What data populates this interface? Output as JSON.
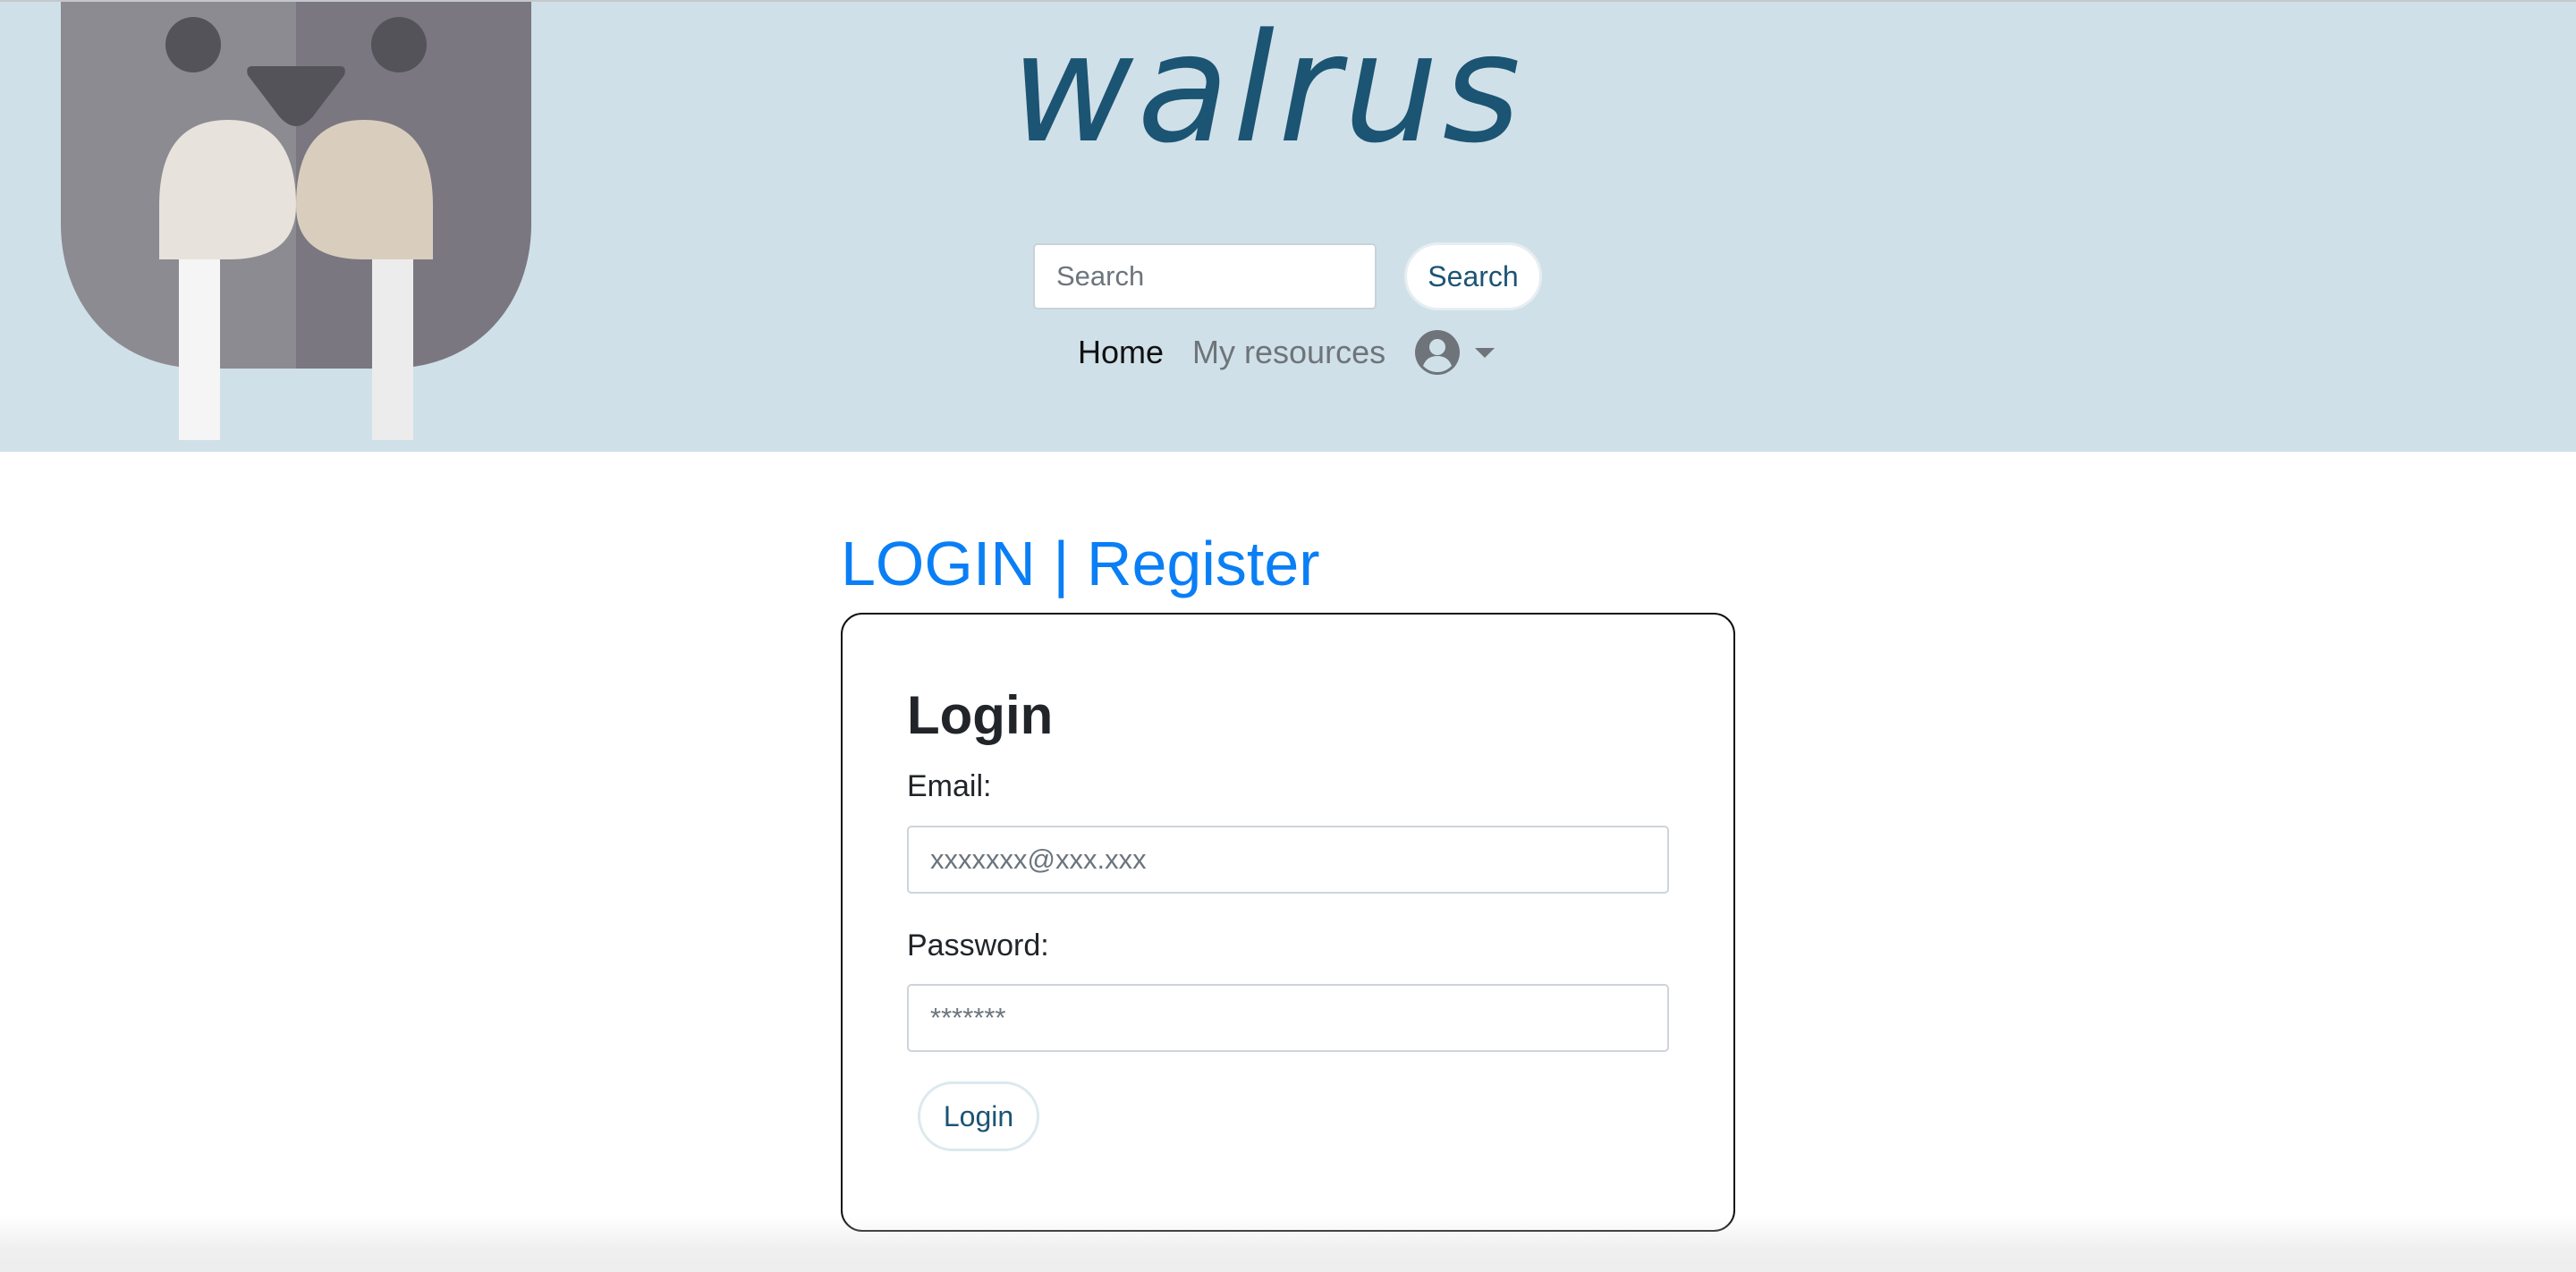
{
  "header": {
    "brand": "walrus",
    "logo_icon": "walrus-face-icon",
    "background_color": "#d0e0e8",
    "brand_color": "#1c5473",
    "search": {
      "placeholder": "Search",
      "value": "",
      "button_label": "Search"
    },
    "nav": {
      "home_label": "Home",
      "resources_label": "My resources",
      "user_icon": "user-circle-icon",
      "dropdown_icon": "caret-down-icon"
    }
  },
  "main": {
    "auth_heading": {
      "login_label": "LOGIN",
      "separator": " | ",
      "register_label": "Register",
      "color": "#0a7ff5"
    },
    "login_form": {
      "title": "Login",
      "email_label": "Email:",
      "email_placeholder": "xxxxxxx@xxx.xxx",
      "email_value": "",
      "password_label": "Password:",
      "password_placeholder": "*******",
      "password_value": "",
      "submit_label": "Login"
    }
  }
}
